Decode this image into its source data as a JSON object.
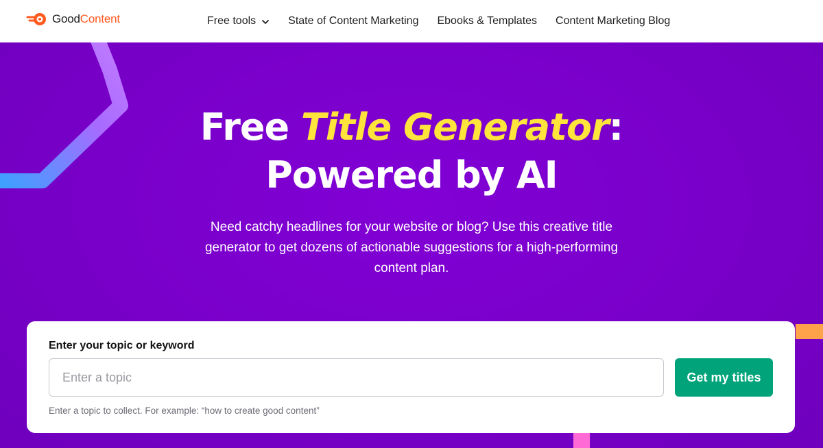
{
  "brand": {
    "name_part1": "Good",
    "name_part2": "Content",
    "accent_color": "#ff5a1f",
    "logo_icon": "semrush-fire-icon"
  },
  "nav": {
    "items": [
      {
        "label": "Free tools",
        "has_dropdown": true
      },
      {
        "label": "State of Content Marketing"
      },
      {
        "label": "Ebooks & Templates"
      },
      {
        "label": "Content Marketing Blog"
      }
    ]
  },
  "hero": {
    "title_prefix": "Free ",
    "title_highlight": "Title Generator",
    "title_suffix": ":",
    "title_line2": "Powered by AI",
    "subtitle": "Need catchy headlines for your website or blog? Use this creative title generator to get dozens of actionable suggestions for a high-performing content plan.",
    "background_color": "#7a00cc",
    "highlight_color": "#ffe53b"
  },
  "form": {
    "label": "Enter your topic or keyword",
    "input_value": "",
    "input_placeholder": "Enter a topic",
    "button_label": "Get my titles",
    "button_color": "#00a37a",
    "hint": "Enter a topic to collect. For example: “how to create good content”"
  }
}
